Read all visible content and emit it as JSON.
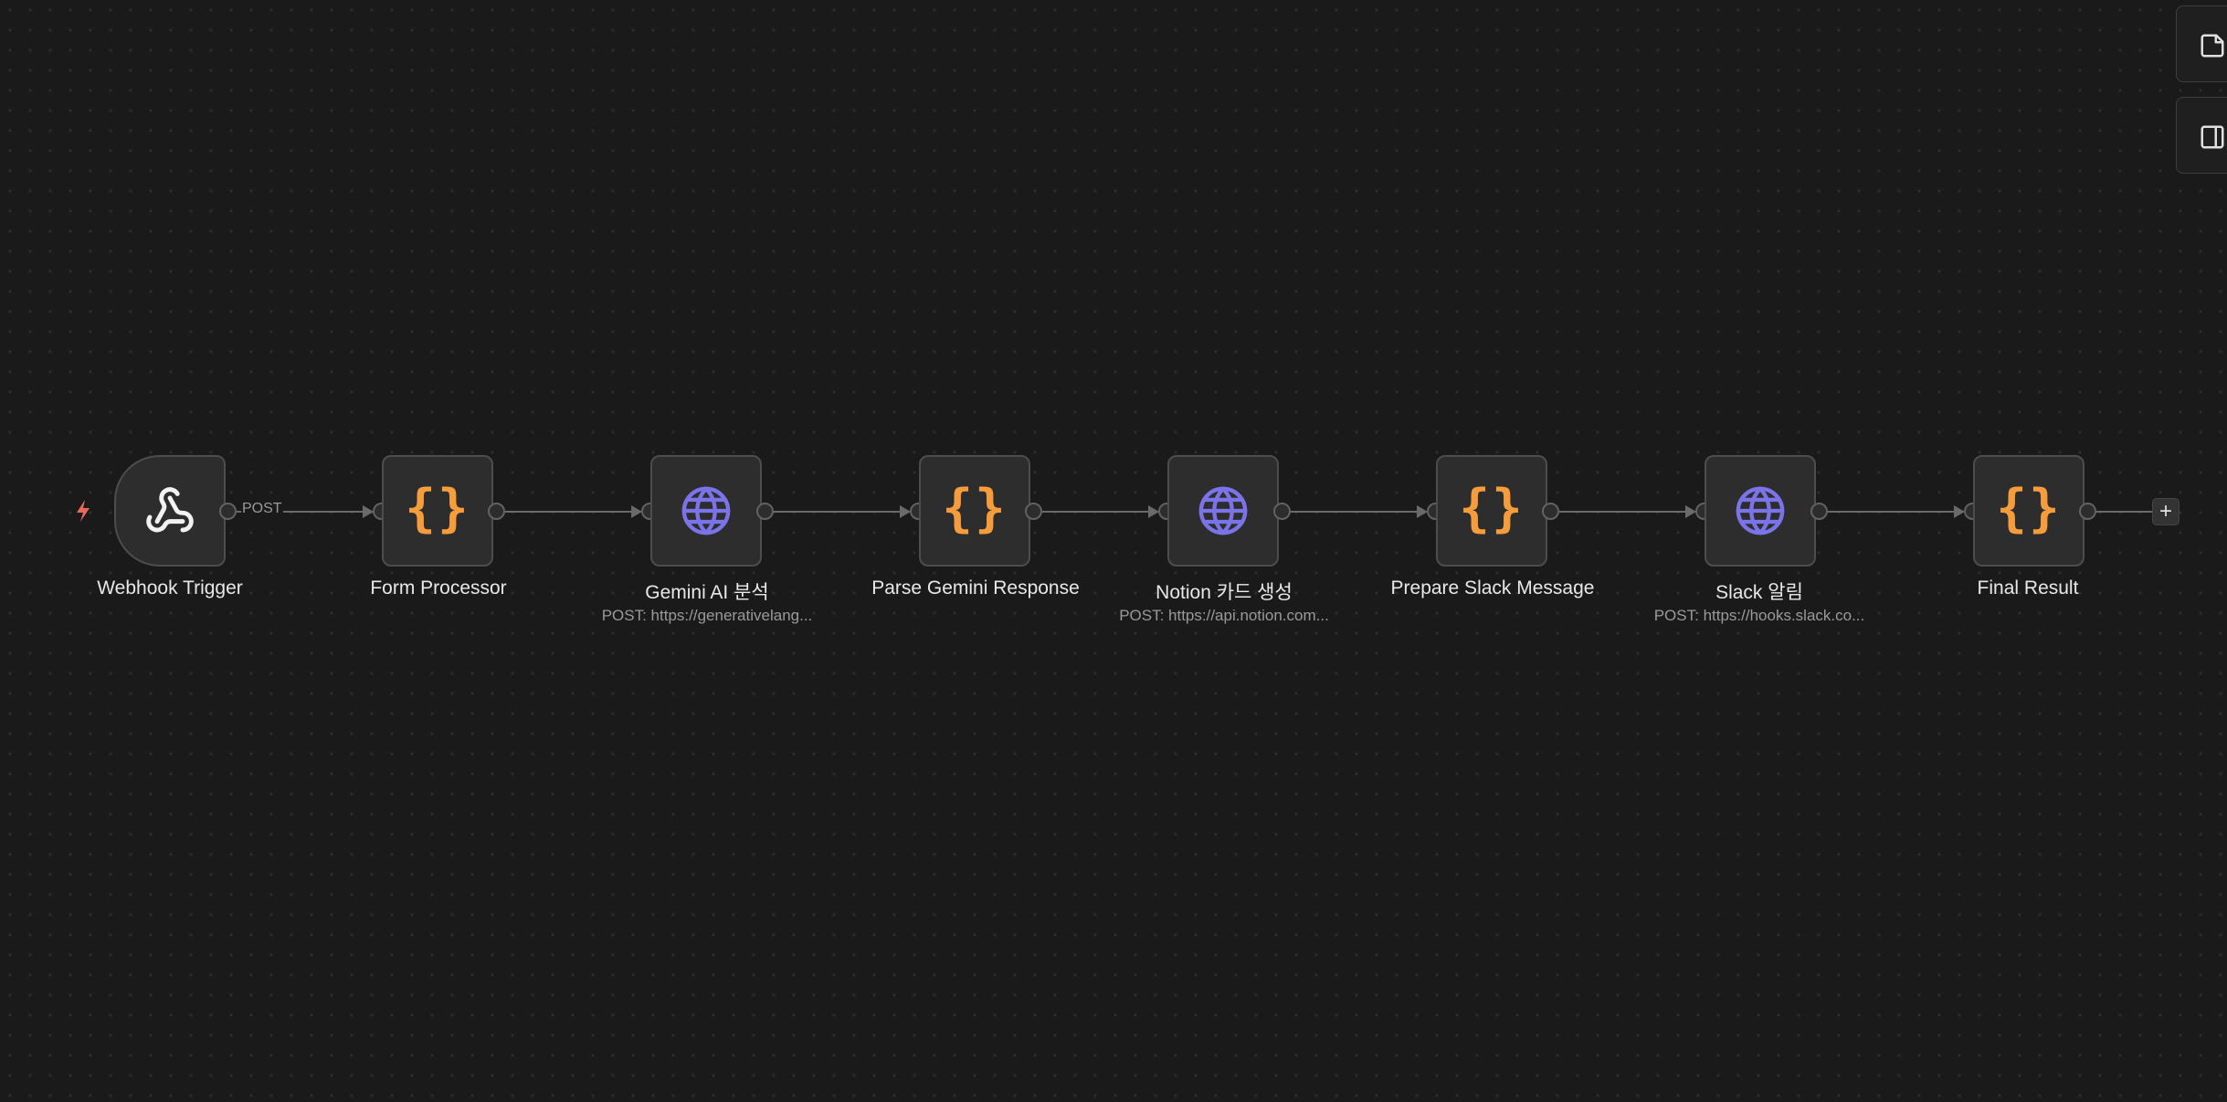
{
  "workflow": {
    "accent_colors": {
      "code_icon": "#f59d3c",
      "http_icon": "#7b74e8",
      "trigger_bolt": "#e86a5c",
      "canvas_bg": "#1a1a1a",
      "node_bg": "#2d2d2d"
    },
    "nodes": [
      {
        "name": "Webhook Trigger",
        "subtitle": "",
        "icon": "webhook-icon",
        "type": "trigger"
      },
      {
        "name": "Form Processor",
        "subtitle": "",
        "icon": "code-braces-icon",
        "type": "code"
      },
      {
        "name": "Gemini AI 분석",
        "subtitle": "POST: https://generativelang...",
        "icon": "globe-icon",
        "type": "http"
      },
      {
        "name": "Parse Gemini Response",
        "subtitle": "",
        "icon": "code-braces-icon",
        "type": "code"
      },
      {
        "name": "Notion 카드 생성",
        "subtitle": "POST: https://api.notion.com...",
        "icon": "globe-icon",
        "type": "http"
      },
      {
        "name": "Prepare Slack Message",
        "subtitle": "",
        "icon": "code-braces-icon",
        "type": "code"
      },
      {
        "name": "Slack 알림",
        "subtitle": "POST: https://hooks.slack.co...",
        "icon": "globe-icon",
        "type": "http"
      },
      {
        "name": "Final Result",
        "subtitle": "",
        "icon": "code-braces-icon",
        "type": "code"
      }
    ],
    "first_edge_label": "POST",
    "code_icon_text": "{}",
    "add_node_label": "+",
    "side_toolbar": [
      {
        "icon": "sticky-note-icon"
      },
      {
        "icon": "panel-right-icon"
      }
    ]
  }
}
